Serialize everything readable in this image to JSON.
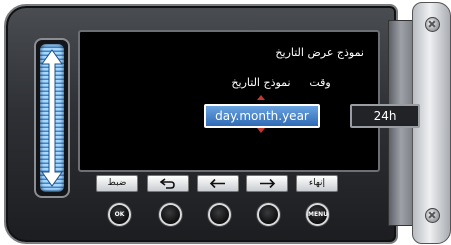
{
  "screen": {
    "title": "نموذج عرض التاريخ",
    "date_format_label": "نموذج التاريخ",
    "time_label": "وقت",
    "date_format_value": "day.month.year",
    "time_value": "24h"
  },
  "softkeys": {
    "set": "ضبط",
    "finish": "إنهاء"
  },
  "hardware_buttons": {
    "ok": "OK",
    "menu": "MENU"
  },
  "icons": {
    "back": "return-arrow-icon",
    "left": "left-arrow-icon",
    "right": "right-arrow-icon",
    "slider": "up-down-arrow-icon"
  },
  "colors": {
    "selected_field": "#2f6bb5",
    "indicator_arrow": "#c0392b",
    "slider": "#3f86c8"
  }
}
